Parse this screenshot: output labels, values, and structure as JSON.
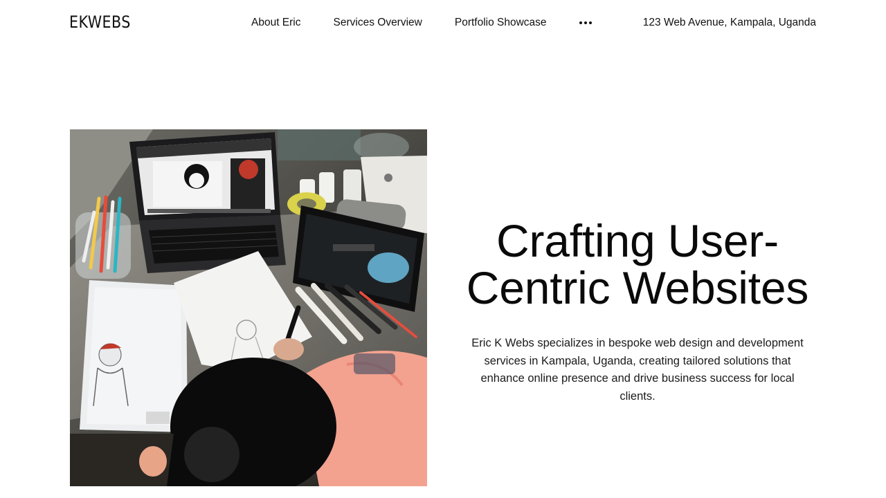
{
  "header": {
    "logo": "EKWEBS",
    "nav": [
      {
        "label": "About Eric"
      },
      {
        "label": "Services Overview"
      },
      {
        "label": "Portfolio Showcase"
      }
    ],
    "more_icon": "more-horizontal-icon",
    "address": "123 Web Avenue, Kampala, Uganda"
  },
  "hero": {
    "image_subject": "desk-with-laptop-tablet-and-sketches",
    "title": "Crafting User-Centric Websites",
    "description": "Eric K Webs specializes in bespoke web design and development services in Kampala, Uganda, creating tailored solutions that enhance online presence and drive business success for local clients."
  }
}
